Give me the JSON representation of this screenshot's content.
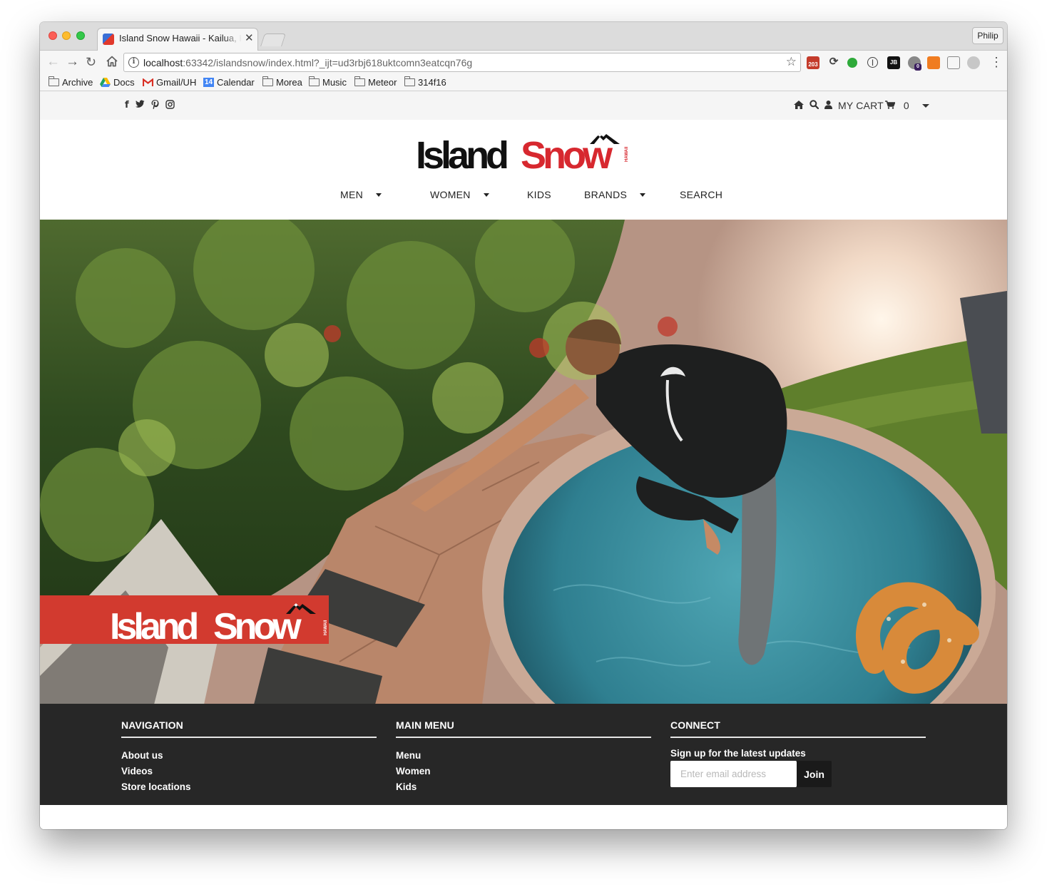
{
  "browser": {
    "tab_title": "Island Snow Hawaii - Kailua, H",
    "tab_close": "✕",
    "profile": "Philip",
    "url_host": "localhost",
    "url_rest": ":63342/islandsnow/index.html?_ijt=ud3rbj618uktcomn3eatcqn76g",
    "extension_badges": [
      "203",
      "0"
    ],
    "bookmarks": [
      "Archive",
      "Docs",
      "Gmail/UH",
      "Calendar",
      "Morea",
      "Music",
      "Meteor",
      "314f16"
    ],
    "calendar_icon_text": "14"
  },
  "site": {
    "topbar": {
      "cart_label": "MY CART",
      "cart_count": "0"
    },
    "logo": {
      "word1": "Island",
      "word2": "Snow",
      "tag": "HAWAII"
    },
    "nav": [
      "MEN",
      "WOMEN",
      "KIDS",
      "BRANDS",
      "SEARCH"
    ],
    "hero_banner": {
      "word1": "Island",
      "word2": "Snow",
      "tag": "HAWAII"
    },
    "footer": {
      "navigation": {
        "title": "NAVIGATION",
        "links": [
          "About us",
          "Videos",
          "Store locations"
        ]
      },
      "main_menu": {
        "title": "MAIN MENU",
        "links": [
          "Menu",
          "Women",
          "Kids"
        ]
      },
      "connect": {
        "title": "CONNECT",
        "signup_text": "Sign up for the latest updates",
        "email_placeholder": "Enter email address",
        "join_label": "Join"
      }
    }
  },
  "colors": {
    "brand_red": "#d7282f",
    "footer_bg": "#272727",
    "topbar_bg": "#f5f5f5"
  }
}
